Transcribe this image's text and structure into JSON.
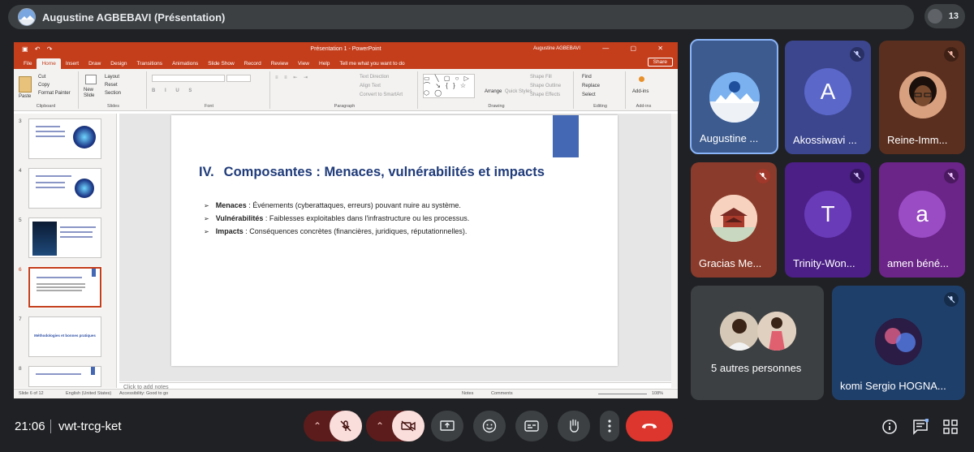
{
  "meeting": {
    "presenter_title": "Augustine AGBEBAVI (Présentation)",
    "participant_count": "13",
    "time": "21:06",
    "code": "vwt-trcg-ket"
  },
  "ppt": {
    "doc_title": "Présentation 1 - PowerPoint",
    "user": "Augustine AGBEBAVI",
    "tabs": [
      "File",
      "Home",
      "Insert",
      "Draw",
      "Design",
      "Transitions",
      "Animations",
      "Slide Show",
      "Record",
      "Review",
      "View",
      "Help"
    ],
    "tell_me": "Tell me what you want to do",
    "share": "Share",
    "ribbon": {
      "paste": "Paste",
      "cut": "Cut",
      "copy": "Copy",
      "format_painter": "Format Painter",
      "clipboard": "Clipboard",
      "new_slide": "New Slide",
      "layout": "Layout",
      "reset": "Reset",
      "section": "Section",
      "slides": "Slides",
      "font": "Font",
      "text_direction": "Text Direction",
      "align_text": "Align Text",
      "convert_smartart": "Convert to SmartArt",
      "paragraph": "Paragraph",
      "arrange": "Arrange",
      "quick_styles": "Quick Styles",
      "shape_fill": "Shape Fill",
      "shape_outline": "Shape Outline",
      "shape_effects": "Shape Effects",
      "drawing": "Drawing",
      "find": "Find",
      "replace": "Replace",
      "select": "Select",
      "editing": "Editing",
      "addins": "Add-ins",
      "addins_group": "Add-ins"
    },
    "thumbs": [
      {
        "num": "3"
      },
      {
        "num": "4"
      },
      {
        "num": "5"
      },
      {
        "num": "6"
      },
      {
        "num": "7",
        "text": "Méthodologies et bonnes pratiques"
      },
      {
        "num": "8"
      }
    ],
    "slide": {
      "heading_num": "IV.",
      "heading": "Composantes : Menaces, vulnérabilités et impacts",
      "bullets": [
        {
          "bold": "Menaces",
          "text": " : Événements (cyberattaques, erreurs) pouvant nuire au système."
        },
        {
          "bold": "Vulnérabilités",
          "text": " : Faiblesses exploitables dans l'infrastructure ou les processus."
        },
        {
          "bold": "Impacts",
          "text": " : Conséquences concrètes (financières, juridiques, réputationnelles)."
        }
      ]
    },
    "notes_placeholder": "Click to add notes",
    "status": {
      "slide": "Slide 6 of 12",
      "lang": "English (United States)",
      "access": "Accessibility: Good to go",
      "notes": "Notes",
      "comments": "Comments",
      "zoom": "108%"
    }
  },
  "participants": [
    {
      "name": "Augustine ..."
    },
    {
      "name": "Akossiwavi ...",
      "initial": "A"
    },
    {
      "name": "Reine-Imm..."
    },
    {
      "name": "Gracias Me..."
    },
    {
      "name": "Trinity-Won...",
      "initial": "T"
    },
    {
      "name": "amen béné...",
      "initial": "a"
    },
    {
      "name": "5 autres personnes"
    },
    {
      "name": "komi Sergio HOGNA..."
    }
  ]
}
